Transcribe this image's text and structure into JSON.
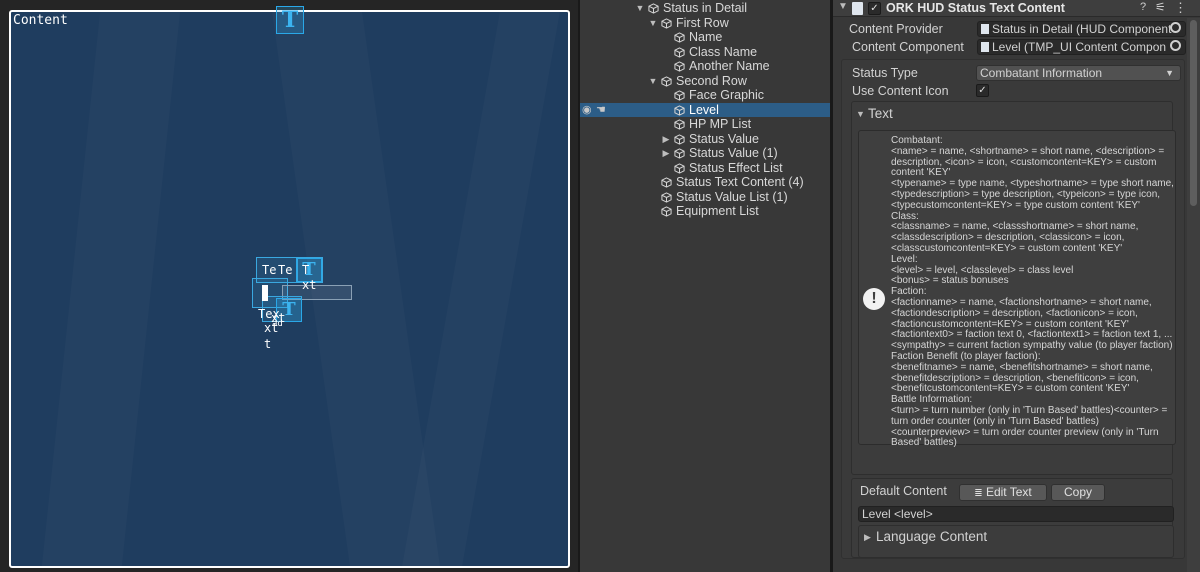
{
  "scene": {
    "content_label": "Content",
    "gizmo_glyph": "T",
    "cluster_lines": [
      "Te",
      "Te",
      "T",
      "xt",
      "Tex",
      "xt",
      "xt",
      "t",
      "ad"
    ]
  },
  "hierarchy": {
    "items": [
      {
        "label": "Status in Detail",
        "depth": 0,
        "arrow": "down",
        "selected": false
      },
      {
        "label": "First Row",
        "depth": 1,
        "arrow": "down",
        "selected": false
      },
      {
        "label": "Name",
        "depth": 2,
        "arrow": "",
        "selected": false
      },
      {
        "label": "Class Name",
        "depth": 2,
        "arrow": "",
        "selected": false
      },
      {
        "label": "Another Name",
        "depth": 2,
        "arrow": "",
        "selected": false
      },
      {
        "label": "Second Row",
        "depth": 1,
        "arrow": "down",
        "selected": false
      },
      {
        "label": "Face Graphic",
        "depth": 2,
        "arrow": "",
        "selected": false
      },
      {
        "label": "Level",
        "depth": 2,
        "arrow": "",
        "selected": true
      },
      {
        "label": "HP MP List",
        "depth": 2,
        "arrow": "",
        "selected": false
      },
      {
        "label": "Status Value",
        "depth": 2,
        "arrow": "right",
        "selected": false
      },
      {
        "label": "Status Value (1)",
        "depth": 2,
        "arrow": "right",
        "selected": false
      },
      {
        "label": "Status Effect List",
        "depth": 2,
        "arrow": "",
        "selected": false
      },
      {
        "label": "Status Text Content (4)",
        "depth": 1,
        "arrow": "",
        "selected": false
      },
      {
        "label": "Status Value List (1)",
        "depth": 1,
        "arrow": "",
        "selected": false
      },
      {
        "label": "Equipment List",
        "depth": 1,
        "arrow": "",
        "selected": false
      }
    ]
  },
  "inspector": {
    "component_title": "ORK HUD Status Text Content",
    "help_glyph": "?",
    "settings_glyph": "⚟",
    "menu_glyph": "⋮",
    "content_provider_label": "Content Provider",
    "content_provider_value": "Status in Detail (HUD Component",
    "content_component_label": "Content Component",
    "content_component_value": "Level (TMP_UI Content Compon",
    "status_type_label": "Status Type",
    "status_type_value": "Combatant Information",
    "use_content_icon_label": "Use Content Icon",
    "text_section_label": "Text",
    "help_text": "Combatant:\n<name> = name, <shortname> = short name, <description> = description, <icon> = icon, <customcontent=KEY> = custom content 'KEY'\n<typename> = type name, <typeshortname> = type short name, <typedescription> = type description, <typeicon> = type icon, <typecustomcontent=KEY> = type custom content 'KEY'\nClass:\n<classname> = name, <classshortname> = short name, <classdescription> = description, <classicon> = icon, <classcustomcontent=KEY> = custom content 'KEY'\nLevel:\n<level> = level, <classlevel> = class level\n<bonus> = status bonuses\nFaction:\n<factionname> = name, <factionshortname> = short name, <factiondescription> = description, <factionicon> = icon, <factioncustomcontent=KEY> = custom content 'KEY'\n<factiontext0> = faction text 0, <factiontext1> = faction text 1, ...\n<sympathy> = current faction sympathy value (to player faction)\nFaction Benefit (to player faction):\n<benefitname> = name, <benefitshortname> = short name, <benefitdescription> = description, <benefiticon> = icon, <benefitcustomcontent=KEY> = custom content 'KEY'\nBattle Information:\n<turn> = turn number (only in 'Turn Based' battles)<counter> = turn order counter (only in 'Turn Based' battles)\n<counterpreview> = turn order counter preview (only in 'Turn Based' battles)",
    "default_content_label": "Default Content",
    "edit_text_button": "Edit Text",
    "copy_button": "Copy",
    "default_content_value": "Level <level>",
    "language_content_label": "Language Content"
  },
  "colors": {
    "canvas": "#1f3d5f",
    "selection": "#2c5d87",
    "gizmo": "#2aa8e8"
  }
}
